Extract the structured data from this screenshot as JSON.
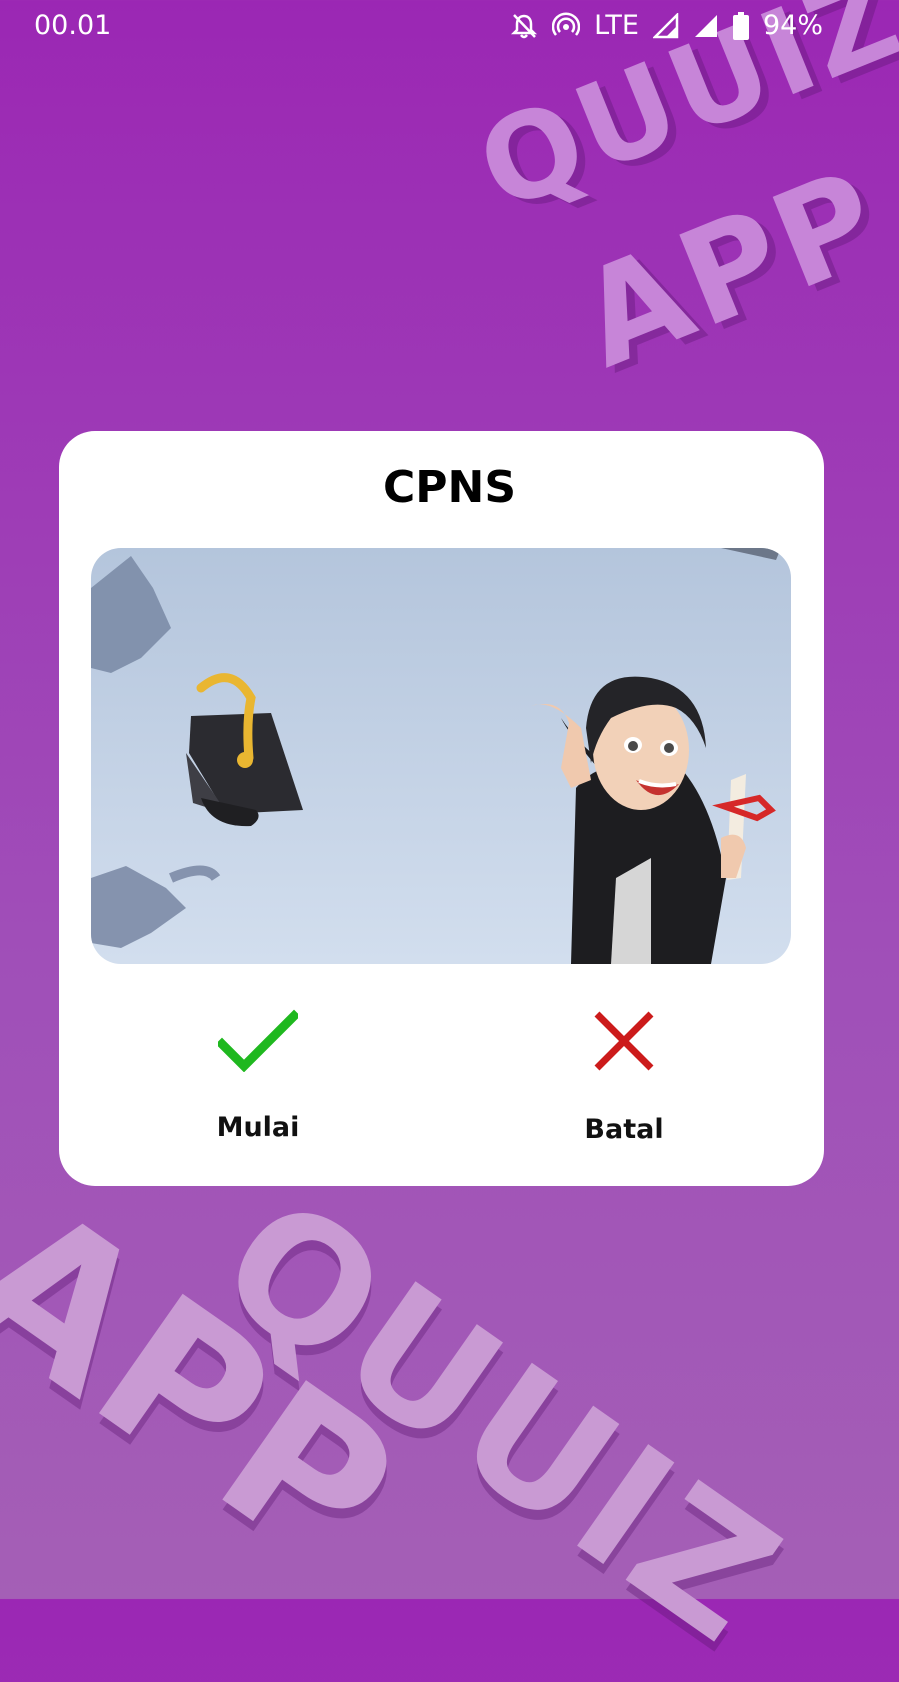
{
  "status_bar": {
    "time": "00.01",
    "network": "LTE",
    "battery": "94%",
    "icons": [
      "bell-off-icon",
      "hotspot-icon",
      "signal-icon",
      "signal-icon",
      "battery-icon"
    ]
  },
  "background": {
    "word_1": "QUUIZ",
    "word_2": "APP",
    "color": "#9b27b4"
  },
  "dialog": {
    "title": "CPNS",
    "image": "graduation-avatar-illustration",
    "start_label": "Mulai",
    "cancel_label": "Batal",
    "start_icon": "check-icon",
    "cancel_icon": "close-icon",
    "check_color": "#1fb81f",
    "close_color": "#cc1b1b"
  }
}
